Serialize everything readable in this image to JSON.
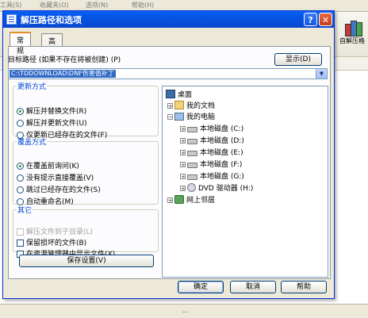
{
  "background": {
    "menu_items": [
      "工具(S)",
      "收藏夹(O)",
      "选项(N)",
      "帮助(H)"
    ],
    "toolbar_button_label": "自解压格",
    "status_text": "..."
  },
  "dialog": {
    "title": "解压路径和选项",
    "help_button": "?",
    "close_button": "✕",
    "tabs": [
      {
        "label": "常规"
      },
      {
        "label": "高级"
      }
    ],
    "target_path_label": "目标路径 (如果不存在将被创建) (P)",
    "show_button": "显示(D)",
    "target_path_value": "C:\\TDDOWNLOAD\\DNF伤害值补丁",
    "update_mode": {
      "legend": "更新方式",
      "options": [
        {
          "label": "解压并替换文件(R)",
          "selected": true
        },
        {
          "label": "解压并更新文件(U)",
          "selected": false
        },
        {
          "label": "仅更新已经存在的文件(F)",
          "selected": false
        }
      ]
    },
    "overwrite_mode": {
      "legend": "覆盖方式",
      "options": [
        {
          "label": "在覆盖前询问(K)",
          "selected": true
        },
        {
          "label": "没有提示直接覆盖(V)",
          "selected": false
        },
        {
          "label": "跳过已经存在的文件(S)",
          "selected": false
        },
        {
          "label": "自动重命名(M)",
          "selected": false
        }
      ]
    },
    "misc": {
      "legend": "其它",
      "options": [
        {
          "label": "解压文件到子目录(L)",
          "checked": false,
          "disabled": true
        },
        {
          "label": "保留损坏的文件(B)",
          "checked": false,
          "disabled": false
        },
        {
          "label": "在资源管理器中显示文件(X)",
          "checked": false,
          "disabled": false
        }
      ]
    },
    "save_settings_button": "保存设置(V)",
    "tree": {
      "desktop": "桌面",
      "my_documents": "我的文档",
      "my_computer": "我的电脑",
      "drives": [
        "本地磁盘 (C:)",
        "本地磁盘 (D:)",
        "本地磁盘 (E:)",
        "本地磁盘 (F:)",
        "本地磁盘 (G:)"
      ],
      "dvd": "DVD 驱动器 (H:)",
      "network": "网上邻居"
    },
    "ok_button": "确定",
    "cancel_button": "取消",
    "help_bottom_button": "帮助"
  }
}
